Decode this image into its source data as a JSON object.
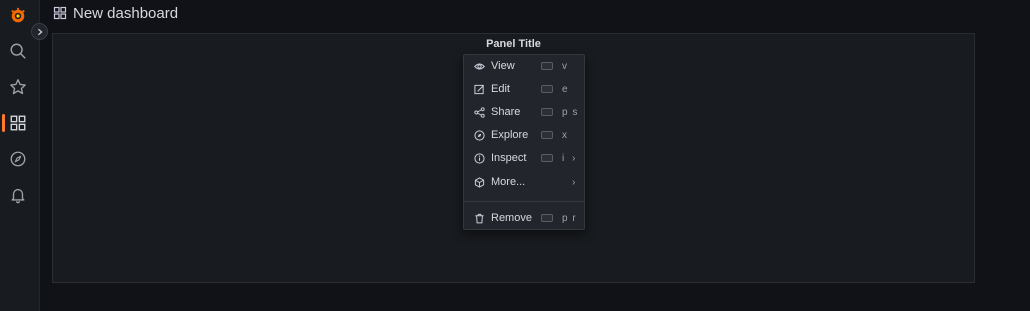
{
  "header": {
    "title": "New dashboard"
  },
  "panel": {
    "title": "Panel Title"
  },
  "menu": {
    "items": [
      {
        "label": "View",
        "keys": "v",
        "icon": "eye-icon"
      },
      {
        "label": "Edit",
        "keys": "e",
        "icon": "edit-icon"
      },
      {
        "label": "Share",
        "keys": "p s",
        "icon": "share-icon"
      },
      {
        "label": "Explore",
        "keys": "x",
        "icon": "compass-icon"
      },
      {
        "label": "Inspect",
        "keys": "i",
        "icon": "info-icon"
      },
      {
        "label": "More...",
        "keys": "",
        "icon": "cube-icon"
      },
      {
        "label": "Remove",
        "keys": "p r",
        "icon": "trash-icon"
      }
    ]
  },
  "colors": {
    "accent": "#ff7a2e",
    "background": "#111217",
    "panel": "#181b1f"
  }
}
